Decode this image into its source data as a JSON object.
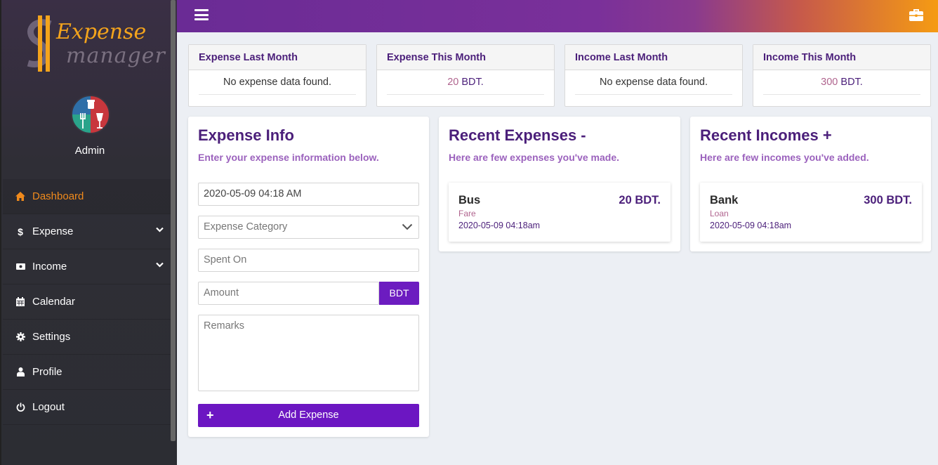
{
  "app": {
    "logo_line1": "Expense",
    "logo_line2": "manager",
    "user_name": "Admin"
  },
  "sidebar": {
    "items": [
      {
        "label": "Dashboard",
        "icon": "home-icon",
        "active": true
      },
      {
        "label": "Expense",
        "icon": "dollar-icon",
        "has_submenu": true
      },
      {
        "label": "Income",
        "icon": "money-icon",
        "has_submenu": true
      },
      {
        "label": "Calendar",
        "icon": "calendar-icon"
      },
      {
        "label": "Settings",
        "icon": "gear-icon"
      },
      {
        "label": "Profile",
        "icon": "user-icon"
      },
      {
        "label": "Logout",
        "icon": "power-icon"
      }
    ]
  },
  "stats": [
    {
      "title": "Expense Last Month",
      "empty": "No expense data found."
    },
    {
      "title": "Expense This Month",
      "value": "20",
      "unit": "BDT."
    },
    {
      "title": "Income Last Month",
      "empty": "No expense data found."
    },
    {
      "title": "Income This Month",
      "value": "300",
      "unit": "BDT."
    }
  ],
  "expense_form": {
    "title": "Expense Info",
    "subtitle": "Enter your expense information below.",
    "date_value": "2020-05-09 04:18 AM",
    "category_placeholder": "Expense Category",
    "spent_on_placeholder": "Spent On",
    "amount_placeholder": "Amount",
    "currency": "BDT",
    "remarks_placeholder": "Remarks",
    "submit_label": "Add Expense"
  },
  "recent_expenses": {
    "title": "Recent Expenses -",
    "subtitle": "Here are few expenses you've made.",
    "items": [
      {
        "title": "Bus",
        "amount": "20 BDT.",
        "category": "Fare",
        "date": "2020-05-09 04:18am"
      }
    ]
  },
  "recent_incomes": {
    "title": "Recent Incomes +",
    "subtitle": "Here are few incomes you've added.",
    "items": [
      {
        "title": "Bank",
        "amount": "300 BDT.",
        "category": "Loan",
        "date": "2020-05-09 04:18am"
      }
    ]
  },
  "colors": {
    "primary": "#6c16c2",
    "accent": "#f08a1c",
    "heading": "#4b1f7a"
  }
}
